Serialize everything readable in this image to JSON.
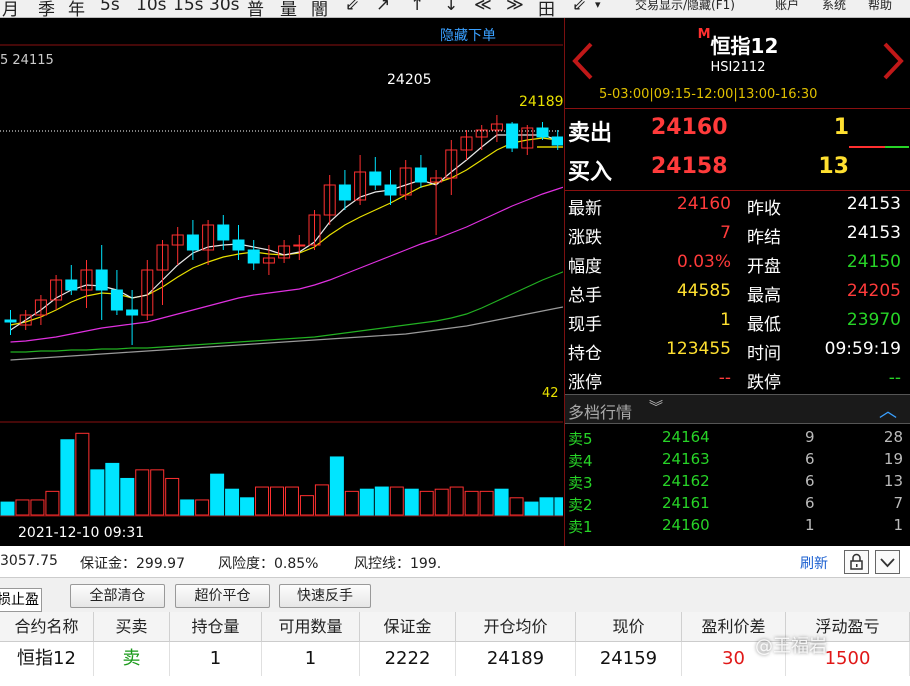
{
  "toolbar": {
    "items": [
      "月",
      "季",
      "年",
      "5s",
      "10s",
      "15s",
      "30s",
      "普",
      "量",
      "闇",
      "⇙",
      "↗",
      "↑",
      "↓",
      "≪",
      "≫",
      "田",
      "⇙"
    ],
    "trade_toggle": "交易显示/隐藏(F1)",
    "account": "账户",
    "system": "系统",
    "help": "帮助"
  },
  "chart": {
    "hide_orders": "隐藏下单",
    "ma_label": "5 24115",
    "high_label": "24205",
    "last_price_label": "24189",
    "volume_axis_label": "42",
    "timestamp": "2021-12-10 09:31",
    "up_color": "#ff3030",
    "down_color": "#00e5ff"
  },
  "chart_data": {
    "type": "candlestick",
    "candles": [
      {
        "o": 24000,
        "h": 24010,
        "l": 23985,
        "c": 23998
      },
      {
        "o": 23995,
        "h": 24010,
        "l": 23990,
        "c": 24005
      },
      {
        "o": 24005,
        "h": 24025,
        "l": 23995,
        "c": 24020
      },
      {
        "o": 24020,
        "h": 24045,
        "l": 24010,
        "c": 24040
      },
      {
        "o": 24040,
        "h": 24055,
        "l": 24025,
        "c": 24030
      },
      {
        "o": 24030,
        "h": 24060,
        "l": 24012,
        "c": 24050
      },
      {
        "o": 24050,
        "h": 24075,
        "l": 24000,
        "c": 24030
      },
      {
        "o": 24030,
        "h": 24050,
        "l": 24005,
        "c": 24010
      },
      {
        "o": 24010,
        "h": 24030,
        "l": 23975,
        "c": 24005
      },
      {
        "o": 24005,
        "h": 24060,
        "l": 24000,
        "c": 24050
      },
      {
        "o": 24050,
        "h": 24080,
        "l": 24015,
        "c": 24075
      },
      {
        "o": 24075,
        "h": 24093,
        "l": 24055,
        "c": 24085
      },
      {
        "o": 24085,
        "h": 24100,
        "l": 24060,
        "c": 24070
      },
      {
        "o": 24070,
        "h": 24100,
        "l": 24055,
        "c": 24095
      },
      {
        "o": 24095,
        "h": 24105,
        "l": 24070,
        "c": 24080
      },
      {
        "o": 24080,
        "h": 24095,
        "l": 24060,
        "c": 24070
      },
      {
        "o": 24070,
        "h": 24080,
        "l": 24050,
        "c": 24057
      },
      {
        "o": 24057,
        "h": 24075,
        "l": 24045,
        "c": 24062
      },
      {
        "o": 24062,
        "h": 24080,
        "l": 24057,
        "c": 24074
      },
      {
        "o": 24074,
        "h": 24085,
        "l": 24060,
        "c": 24075
      },
      {
        "o": 24075,
        "h": 24110,
        "l": 24070,
        "c": 24105
      },
      {
        "o": 24105,
        "h": 24145,
        "l": 24095,
        "c": 24135
      },
      {
        "o": 24135,
        "h": 24150,
        "l": 24110,
        "c": 24120
      },
      {
        "o": 24120,
        "h": 24165,
        "l": 24115,
        "c": 24148
      },
      {
        "o": 24148,
        "h": 24163,
        "l": 24130,
        "c": 24135
      },
      {
        "o": 24135,
        "h": 24150,
        "l": 24115,
        "c": 24125
      },
      {
        "o": 24125,
        "h": 24160,
        "l": 24120,
        "c": 24152
      },
      {
        "o": 24152,
        "h": 24165,
        "l": 24132,
        "c": 24138
      },
      {
        "o": 24138,
        "h": 24150,
        "l": 24085,
        "c": 24142
      },
      {
        "o": 24142,
        "h": 24180,
        "l": 24125,
        "c": 24170
      },
      {
        "o": 24170,
        "h": 24190,
        "l": 24160,
        "c": 24183
      },
      {
        "o": 24183,
        "h": 24195,
        "l": 24170,
        "c": 24190
      },
      {
        "o": 24190,
        "h": 24205,
        "l": 24178,
        "c": 24196
      },
      {
        "o": 24196,
        "h": 24198,
        "l": 24168,
        "c": 24172
      },
      {
        "o": 24172,
        "h": 24195,
        "l": 24165,
        "c": 24192
      },
      {
        "o": 24192,
        "h": 24198,
        "l": 24180,
        "c": 24183
      },
      {
        "o": 24183,
        "h": 24190,
        "l": 24170,
        "c": 24175
      },
      {
        "o": 24175,
        "h": 24180,
        "l": 24158,
        "c": 24162
      },
      {
        "o": 24162,
        "h": 24168,
        "l": 24145,
        "c": 24152
      }
    ],
    "ma_yellow": [
      23995,
      23998,
      24003,
      24010,
      24018,
      24024,
      24027,
      24026,
      24022,
      24025,
      24033,
      24043,
      24052,
      24058,
      24063,
      24066,
      24068,
      24066,
      24065,
      24067,
      24073,
      24085,
      24095,
      24103,
      24110,
      24117,
      24125,
      24133,
      24137,
      24142,
      24150,
      24160,
      24170,
      24177,
      24180,
      24182,
      24180,
      24175,
      24172
    ],
    "ma_white": [
      23990,
      24000,
      24010,
      24022,
      24030,
      24035,
      24034,
      24030,
      24022,
      24025,
      24040,
      24055,
      24067,
      24073,
      24075,
      24076,
      24073,
      24070,
      24065,
      24068,
      24078,
      24098,
      24112,
      24123,
      24128,
      24130,
      24135,
      24140,
      24135,
      24148,
      24160,
      24173,
      24185,
      24185,
      24185,
      24185,
      24180,
      24172,
      24165
    ],
    "ma_magenta": [
      23978,
      23979,
      23981,
      23983,
      23986,
      23989,
      23992,
      23994,
      23996,
      23998,
      24002,
      24006,
      24010,
      24014,
      24018,
      24022,
      24025,
      24027,
      24029,
      24031,
      24035,
      24040,
      24046,
      24052,
      24058,
      24064,
      24070,
      24076,
      24081,
      24087,
      24093,
      24100,
      24107,
      24114,
      24120,
      24126,
      24131,
      24136,
      24140
    ],
    "ma_green": [
      23968,
      23968,
      23969,
      23969,
      23970,
      23970,
      23971,
      23971,
      23972,
      23972,
      23973,
      23974,
      23975,
      23976,
      23977,
      23978,
      23979,
      23980,
      23981,
      23982,
      23983,
      23985,
      23987,
      23989,
      23991,
      23993,
      23995,
      23997,
      23999,
      24002,
      24006,
      24012,
      24019,
      24026,
      24033,
      24040,
      24046,
      24052,
      24057
    ],
    "ma_gray": [
      23960,
      23961,
      23962,
      23963,
      23964,
      23965,
      23966,
      23967,
      23968,
      23969,
      23970,
      23971,
      23972,
      23973,
      23974,
      23975,
      23976,
      23977,
      23978,
      23979,
      23980,
      23981,
      23982,
      23983,
      23984,
      23985,
      23986,
      23988,
      23990,
      23992,
      23994,
      23997,
      24000,
      24003,
      24006,
      24009,
      24012,
      24015,
      24018
    ],
    "volumes": [
      6,
      7,
      7,
      11,
      35,
      38,
      21,
      24,
      17,
      21,
      21,
      17,
      7,
      7,
      19,
      12,
      8,
      13,
      13,
      13,
      9,
      14,
      27,
      11,
      12,
      13,
      13,
      12,
      11,
      12,
      13,
      11,
      11,
      12,
      8,
      6,
      8,
      8,
      7,
      6,
      3
    ]
  },
  "quote": {
    "badge": "M",
    "name": "恒指12",
    "code": "HSI2112",
    "session": "5-03:00|09:15-12:00|13:00-16:30",
    "sell_label": "卖出",
    "sell_price": "24160",
    "sell_vol": "1",
    "buy_label": "买入",
    "buy_price": "24158",
    "buy_vol": "13",
    "stats": [
      {
        "l1": "最新",
        "v1": "24160",
        "c1": "#ff3b3b",
        "l2": "昨收",
        "v2": "24153",
        "c2": "#ffffff"
      },
      {
        "l1": "涨跌",
        "v1": "7",
        "c1": "#ff3b3b",
        "l2": "昨结",
        "v2": "24153",
        "c2": "#ffffff"
      },
      {
        "l1": "幅度",
        "v1": "0.03%",
        "c1": "#ff3b3b",
        "l2": "开盘",
        "v2": "24150",
        "c2": "#27d427"
      },
      {
        "l1": "总手",
        "v1": "44585",
        "c1": "#ffe030",
        "l2": "最高",
        "v2": "24205",
        "c2": "#ff3b3b"
      },
      {
        "l1": "现手",
        "v1": "1",
        "c1": "#ffe030",
        "l2": "最低",
        "v2": "23970",
        "c2": "#27d427"
      },
      {
        "l1": "持仓",
        "v1": "123455",
        "c1": "#ffe030",
        "l2": "时间",
        "v2": "09:59:19",
        "c2": "#ffffff"
      },
      {
        "l1": "涨停",
        "v1": "--",
        "c1": "#ff3b3b",
        "l2": "跌停",
        "v2": "--",
        "c2": "#27d427"
      }
    ],
    "depth_title": "多档行情",
    "depth": [
      {
        "label": "卖5",
        "price": "24164",
        "vol": "9",
        "num": "28"
      },
      {
        "label": "卖4",
        "price": "24163",
        "vol": "6",
        "num": "19"
      },
      {
        "label": "卖3",
        "price": "24162",
        "vol": "6",
        "num": "13"
      },
      {
        "label": "卖2",
        "price": "24161",
        "vol": "6",
        "num": "7"
      },
      {
        "label": "卖1",
        "price": "24160",
        "vol": "1",
        "num": "1"
      }
    ]
  },
  "account": {
    "equity": "3057.75",
    "margin": "保证金：299.97",
    "risk": "风险度：0.85%",
    "risk_line": "风控线：199.",
    "refresh": "刷新"
  },
  "actions": {
    "stop_tab": "损止盈",
    "close_all": "全部清仓",
    "over_price_close": "超价平仓",
    "quick_reverse": "快速反手"
  },
  "positions": {
    "headers": [
      "合约名称",
      "买卖",
      "持仓量",
      "可用数量",
      "保证金",
      "开仓均价",
      "现价",
      "盈利价差",
      "浮动盈亏"
    ],
    "rows": [
      [
        "恒指12",
        "卖",
        "1",
        "1",
        "2222",
        "24189",
        "24159",
        "30",
        "1500"
      ]
    ]
  },
  "watermark": "@王福岩"
}
